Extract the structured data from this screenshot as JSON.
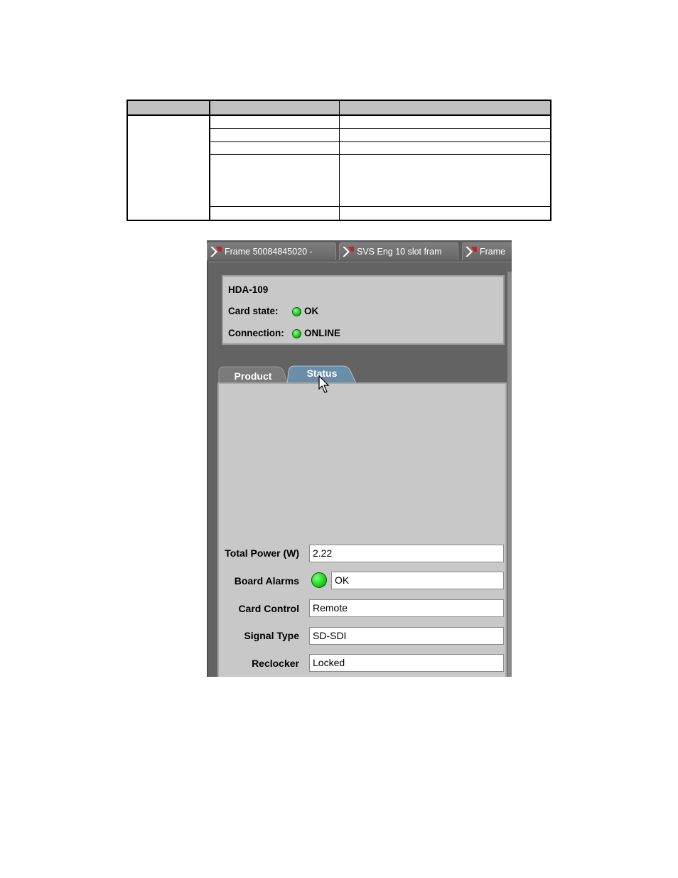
{
  "frame_tabs": [
    {
      "label": "Frame 50084845020 -",
      "icon": "frame-icon"
    },
    {
      "label": "SVS Eng 10 slot fram",
      "icon": "frame-icon"
    },
    {
      "label": "Frame",
      "icon": "frame-icon"
    }
  ],
  "card": {
    "name": "HDA-109",
    "state_label": "Card state:",
    "state_value": "OK",
    "connection_label": "Connection:",
    "connection_value": "ONLINE",
    "led_color": "#22cc22"
  },
  "subtabs": [
    {
      "label": "Product",
      "active": false
    },
    {
      "label": "Status",
      "active": true
    }
  ],
  "status_fields": {
    "total_power": {
      "label": "Total Power (W)",
      "value": "2.22"
    },
    "board_alarms": {
      "label": "Board Alarms",
      "value": "OK"
    },
    "card_control": {
      "label": "Card Control",
      "value": "Remote"
    },
    "signal_type": {
      "label": "Signal Type",
      "value": "SD-SDI"
    },
    "reclocker": {
      "label": "Reclocker",
      "value": "Locked"
    }
  },
  "colors": {
    "window_bg": "#636363",
    "panel_bg": "#c8c8c8",
    "active_tab": "#6a8da8",
    "inactive_tab": "#7a7a7a",
    "led_green": "#22cc22"
  }
}
